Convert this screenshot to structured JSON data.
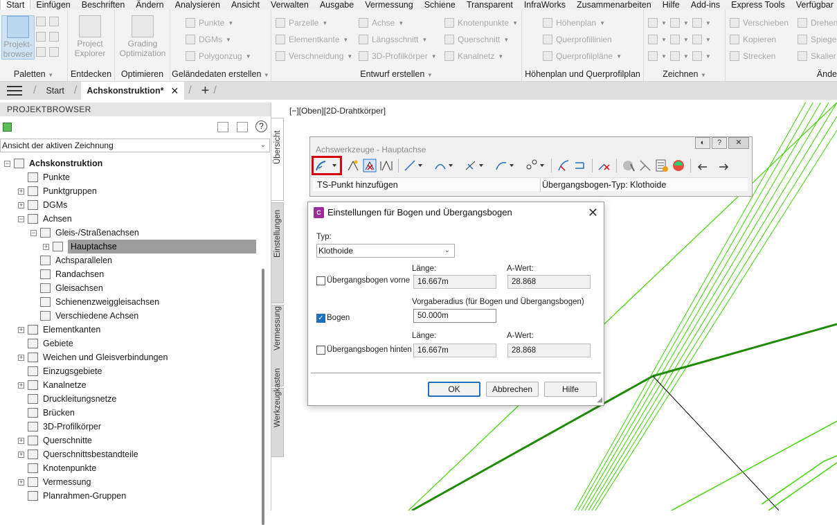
{
  "menubar": {
    "items": [
      "Start",
      "Einfügen",
      "Beschriften",
      "Ändern",
      "Analysieren",
      "Ansicht",
      "Verwalten",
      "Ausgabe",
      "Vermessung",
      "Schiene",
      "Transparent",
      "InfraWorks",
      "Zusammenarbeiten",
      "Hilfe",
      "Add-ins",
      "Express Tools",
      "Verfügbar"
    ]
  },
  "ribbon": {
    "paletten": {
      "title": "Paletten",
      "btn": "Projekt-browser"
    },
    "entdecken": {
      "title": "Entdecken",
      "btn": "Project Explorer"
    },
    "optimieren": {
      "title": "Optimieren",
      "btn": "Grading Optimization"
    },
    "gelaende": {
      "title": "Geländedaten erstellen",
      "rows": [
        "Punkte",
        "DGMs",
        "Polygonzug"
      ]
    },
    "entwurf": {
      "title": "Entwurf erstellen",
      "col1": [
        "Parzelle",
        "Elementkante",
        "Verschneidung"
      ],
      "col2": [
        "Achse",
        "Längsschnitt",
        "3D-Profilkörper"
      ],
      "col3": [
        "Knotenpunkte",
        "Querschnitt",
        "Kanalnetz"
      ]
    },
    "hoehenplan": {
      "title": "Höhenplan und Querprofilplan",
      "rows": [
        "Höhenplan",
        "Querprofillinien",
        "Querprofilpläne"
      ]
    },
    "zeichnen": {
      "title": "Zeichnen"
    },
    "aendern": {
      "title": "Ände",
      "rows": [
        "Verschieben",
        "Kopieren",
        "Strecken"
      ],
      "rows2": [
        "Drehen",
        "Spiege",
        "Skalier"
      ]
    }
  },
  "tabs": {
    "start": "Start",
    "active": "Achskonstruktion*"
  },
  "browser": {
    "header": "PROJEKTBROWSER",
    "view_select": "Ansicht der aktiven Zeichnung",
    "tree": [
      {
        "label": "Achskonstruktion",
        "level": 0,
        "exp": "minus",
        "bold": true
      },
      {
        "label": "Punkte",
        "level": 1,
        "exp": ""
      },
      {
        "label": "Punktgruppen",
        "level": 1,
        "exp": "plus"
      },
      {
        "label": "DGMs",
        "level": 1,
        "exp": "plus"
      },
      {
        "label": "Achsen",
        "level": 1,
        "exp": "minus"
      },
      {
        "label": "Gleis-/Straßenachsen",
        "level": 2,
        "exp": "minus"
      },
      {
        "label": "Hauptachse",
        "level": 3,
        "exp": "plus",
        "selected": true
      },
      {
        "label": "Achsparallelen",
        "level": 2,
        "exp": ""
      },
      {
        "label": "Randachsen",
        "level": 2,
        "exp": ""
      },
      {
        "label": "Gleisachsen",
        "level": 2,
        "exp": ""
      },
      {
        "label": "Schienenzweiggleisachsen",
        "level": 2,
        "exp": ""
      },
      {
        "label": "Verschiedene Achsen",
        "level": 2,
        "exp": ""
      },
      {
        "label": "Elementkanten",
        "level": 1,
        "exp": "plus"
      },
      {
        "label": "Gebiete",
        "level": 1,
        "exp": ""
      },
      {
        "label": "Weichen und Gleisverbindungen",
        "level": 1,
        "exp": "plus"
      },
      {
        "label": "Einzugsgebiete",
        "level": 1,
        "exp": ""
      },
      {
        "label": "Kanalnetze",
        "level": 1,
        "exp": "plus"
      },
      {
        "label": "Druckleitungsnetze",
        "level": 1,
        "exp": ""
      },
      {
        "label": "Brücken",
        "level": 1,
        "exp": ""
      },
      {
        "label": "3D-Profilkörper",
        "level": 1,
        "exp": ""
      },
      {
        "label": "Querschnitte",
        "level": 1,
        "exp": "plus"
      },
      {
        "label": "Querschnittsbestandteile",
        "level": 1,
        "exp": "plus"
      },
      {
        "label": "Knotenpunkte",
        "level": 1,
        "exp": ""
      },
      {
        "label": "Vermessung",
        "level": 1,
        "exp": "plus"
      },
      {
        "label": "Planrahmen-Gruppen",
        "level": 1,
        "exp": ""
      }
    ]
  },
  "sidetabs": [
    "Übersicht",
    "Einstellungen",
    "Vermessung",
    "Werkzeugkasten"
  ],
  "viewport": {
    "label": "[−][Oben][2D-Drahtkörper]"
  },
  "toolwin": {
    "title": "Achswerkzeuge - Hauptachse",
    "status_left": "TS-Punkt hinzufügen",
    "status_right": "Übergangsbogen-Typ: Klothoide"
  },
  "dialog": {
    "title": "Einstellungen für Bogen und Übergangsbogen",
    "logo": "C",
    "typ_label": "Typ:",
    "typ_value": "Klothoide",
    "laenge_label": "Länge:",
    "awert_label": "A-Wert:",
    "vorne_label": "Übergangsbogen vorne",
    "vorne_laenge": "16.667m",
    "vorne_awert": "28.868",
    "radius_label": "Vorgaberadius (für Bogen und Übergangsbogen)",
    "bogen_label": "Bogen",
    "radius_value": "50.000m",
    "hinten_label": "Übergangsbogen hinten",
    "hinten_laenge": "16.667m",
    "hinten_awert": "28.868",
    "ok": "OK",
    "cancel": "Abbrechen",
    "help": "Hilfe"
  },
  "colors": {
    "accent": "#1f6fbf",
    "highlight": "#d9000d",
    "geometry_green": "#3fd400",
    "geometry_dark": "#1e8a00"
  }
}
